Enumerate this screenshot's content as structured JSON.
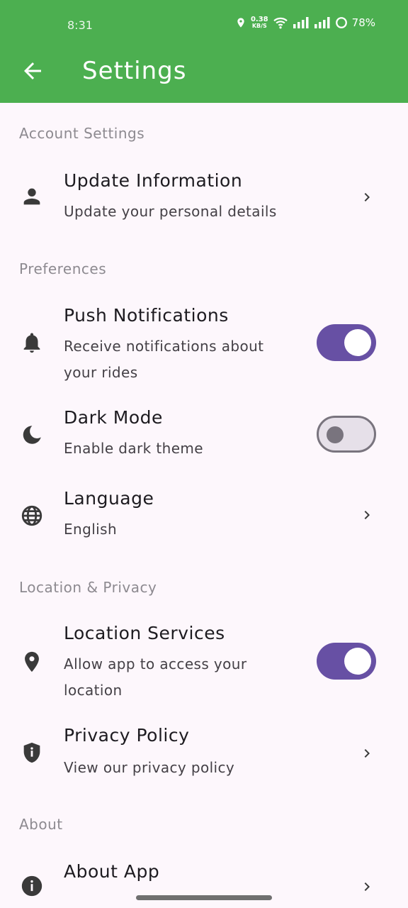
{
  "status_bar": {
    "time": "8:31",
    "speed_value": "0.38",
    "speed_unit": "KB/S",
    "battery": "78%"
  },
  "header": {
    "title": "Settings"
  },
  "sections": {
    "account": "Account Settings",
    "preferences": "Preferences",
    "location_privacy": "Location & Privacy",
    "about": "About"
  },
  "items": {
    "update_info": {
      "title": "Update Information",
      "subtitle": "Update your personal details"
    },
    "push": {
      "title": "Push Notifications",
      "subtitle": "Receive notifications about your rides",
      "enabled": true
    },
    "dark": {
      "title": "Dark Mode",
      "subtitle": "Enable dark theme",
      "enabled": false
    },
    "language": {
      "title": "Language",
      "subtitle": "English"
    },
    "location": {
      "title": "Location Services",
      "subtitle": "Allow app to access your location",
      "enabled": true
    },
    "privacy": {
      "title": "Privacy Policy",
      "subtitle": "View our privacy policy"
    },
    "about_app": {
      "title": "About App"
    }
  },
  "colors": {
    "appbar": "#4CAF50",
    "accent": "#6750A4",
    "background": "#FDF7FC"
  }
}
